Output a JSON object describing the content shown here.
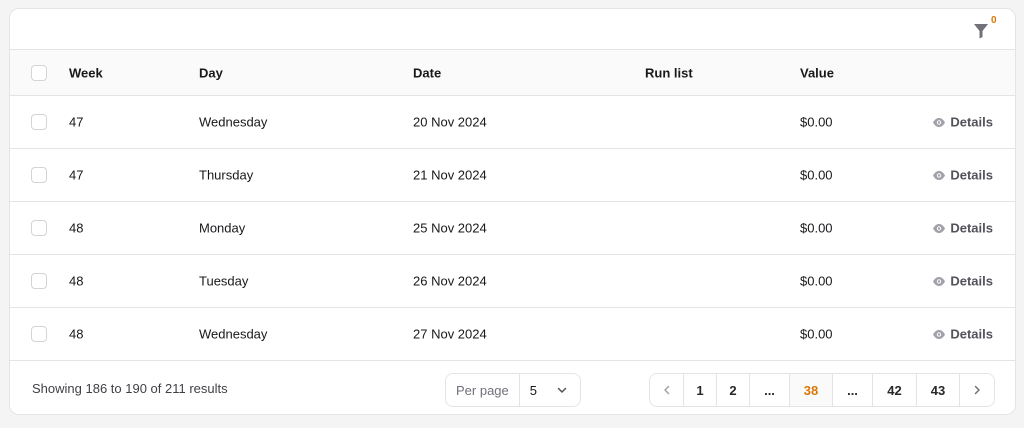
{
  "filter": {
    "icon": "filter-icon",
    "count": "0"
  },
  "table": {
    "headers": {
      "week": "Week",
      "day": "Day",
      "date": "Date",
      "run_list": "Run list",
      "value": "Value"
    },
    "rows": [
      {
        "week": "47",
        "day": "Wednesday",
        "date": "20 Nov 2024",
        "run_list": "",
        "value": "$0.00",
        "action": "Details"
      },
      {
        "week": "47",
        "day": "Thursday",
        "date": "21 Nov 2024",
        "run_list": "",
        "value": "$0.00",
        "action": "Details"
      },
      {
        "week": "48",
        "day": "Monday",
        "date": "25 Nov 2024",
        "run_list": "",
        "value": "$0.00",
        "action": "Details"
      },
      {
        "week": "48",
        "day": "Tuesday",
        "date": "26 Nov 2024",
        "run_list": "",
        "value": "$0.00",
        "action": "Details"
      },
      {
        "week": "48",
        "day": "Wednesday",
        "date": "27 Nov 2024",
        "run_list": "",
        "value": "$0.00",
        "action": "Details"
      }
    ]
  },
  "footer": {
    "showing": "Showing 186 to 190 of 211 results",
    "per_page_label": "Per page",
    "per_page_value": "5",
    "pages": [
      "1",
      "2",
      "...",
      "38",
      "...",
      "42",
      "43"
    ],
    "current_page": "38"
  },
  "colors": {
    "accent": "#d97706",
    "border": "#e4e4e7",
    "header_bg": "#fafafa"
  }
}
